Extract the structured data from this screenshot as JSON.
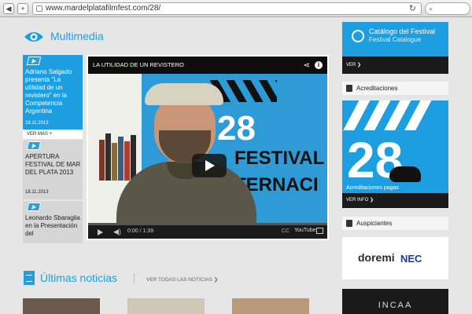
{
  "browser": {
    "url": "www.mardelplatafilmfest.com/28/",
    "back_label": "◀",
    "add_tab_label": "+",
    "reload_glyph": "↻",
    "search_glyph": "⌕"
  },
  "multimedia": {
    "title": "Multimedia",
    "items": [
      {
        "text": "Adriano Salgado presenta \"La utilidad de un revistero\" en la Competencia Argentina",
        "date": "18.11.2013"
      },
      {
        "text": "APERTURA FESTIVAL DE MAR DEL PLATA 2013",
        "date": "18.11.2013"
      },
      {
        "text": "Leonardo Sbaraglia en la Presentación del",
        "date": ""
      }
    ],
    "ver_mas": "VER MÁS +"
  },
  "player": {
    "title": "LA UTILIDAD DE UN REVISTERO",
    "time": "0:00 / 1:39",
    "progress": 0,
    "poster_number": "28",
    "poster_word1": "FESTIVAL",
    "poster_word2": "TERNACI",
    "youtube_label": "YouTube",
    "share_glyph": "⋖",
    "info_glyph": "i",
    "volume_glyph": "◀)",
    "cc_label": "CC"
  },
  "sidebar": {
    "catalog_title": "Catálogo del Festival",
    "catalog_subtitle": "Festival Catalogue",
    "catalog_link": "VER ❯",
    "acreditaciones_label": "Acreditaciones",
    "acred_number": "28",
    "acred_link": "Acreditaciones pagas",
    "acred_ver_info": "VER INFO ❯",
    "auspiciantes_label": "Auspiciantes",
    "sponsor_doremi": "doremi",
    "sponsor_nec": "NEC",
    "sponsor_incaa": "INCAA"
  },
  "news": {
    "title": "Últimas noticias",
    "view_all": "VER TODAS LAS NOTICIAS ❯"
  },
  "colors": {
    "accent": "#1d9ee1",
    "dark": "#1a1a1a",
    "background": "#e6e6e6"
  }
}
